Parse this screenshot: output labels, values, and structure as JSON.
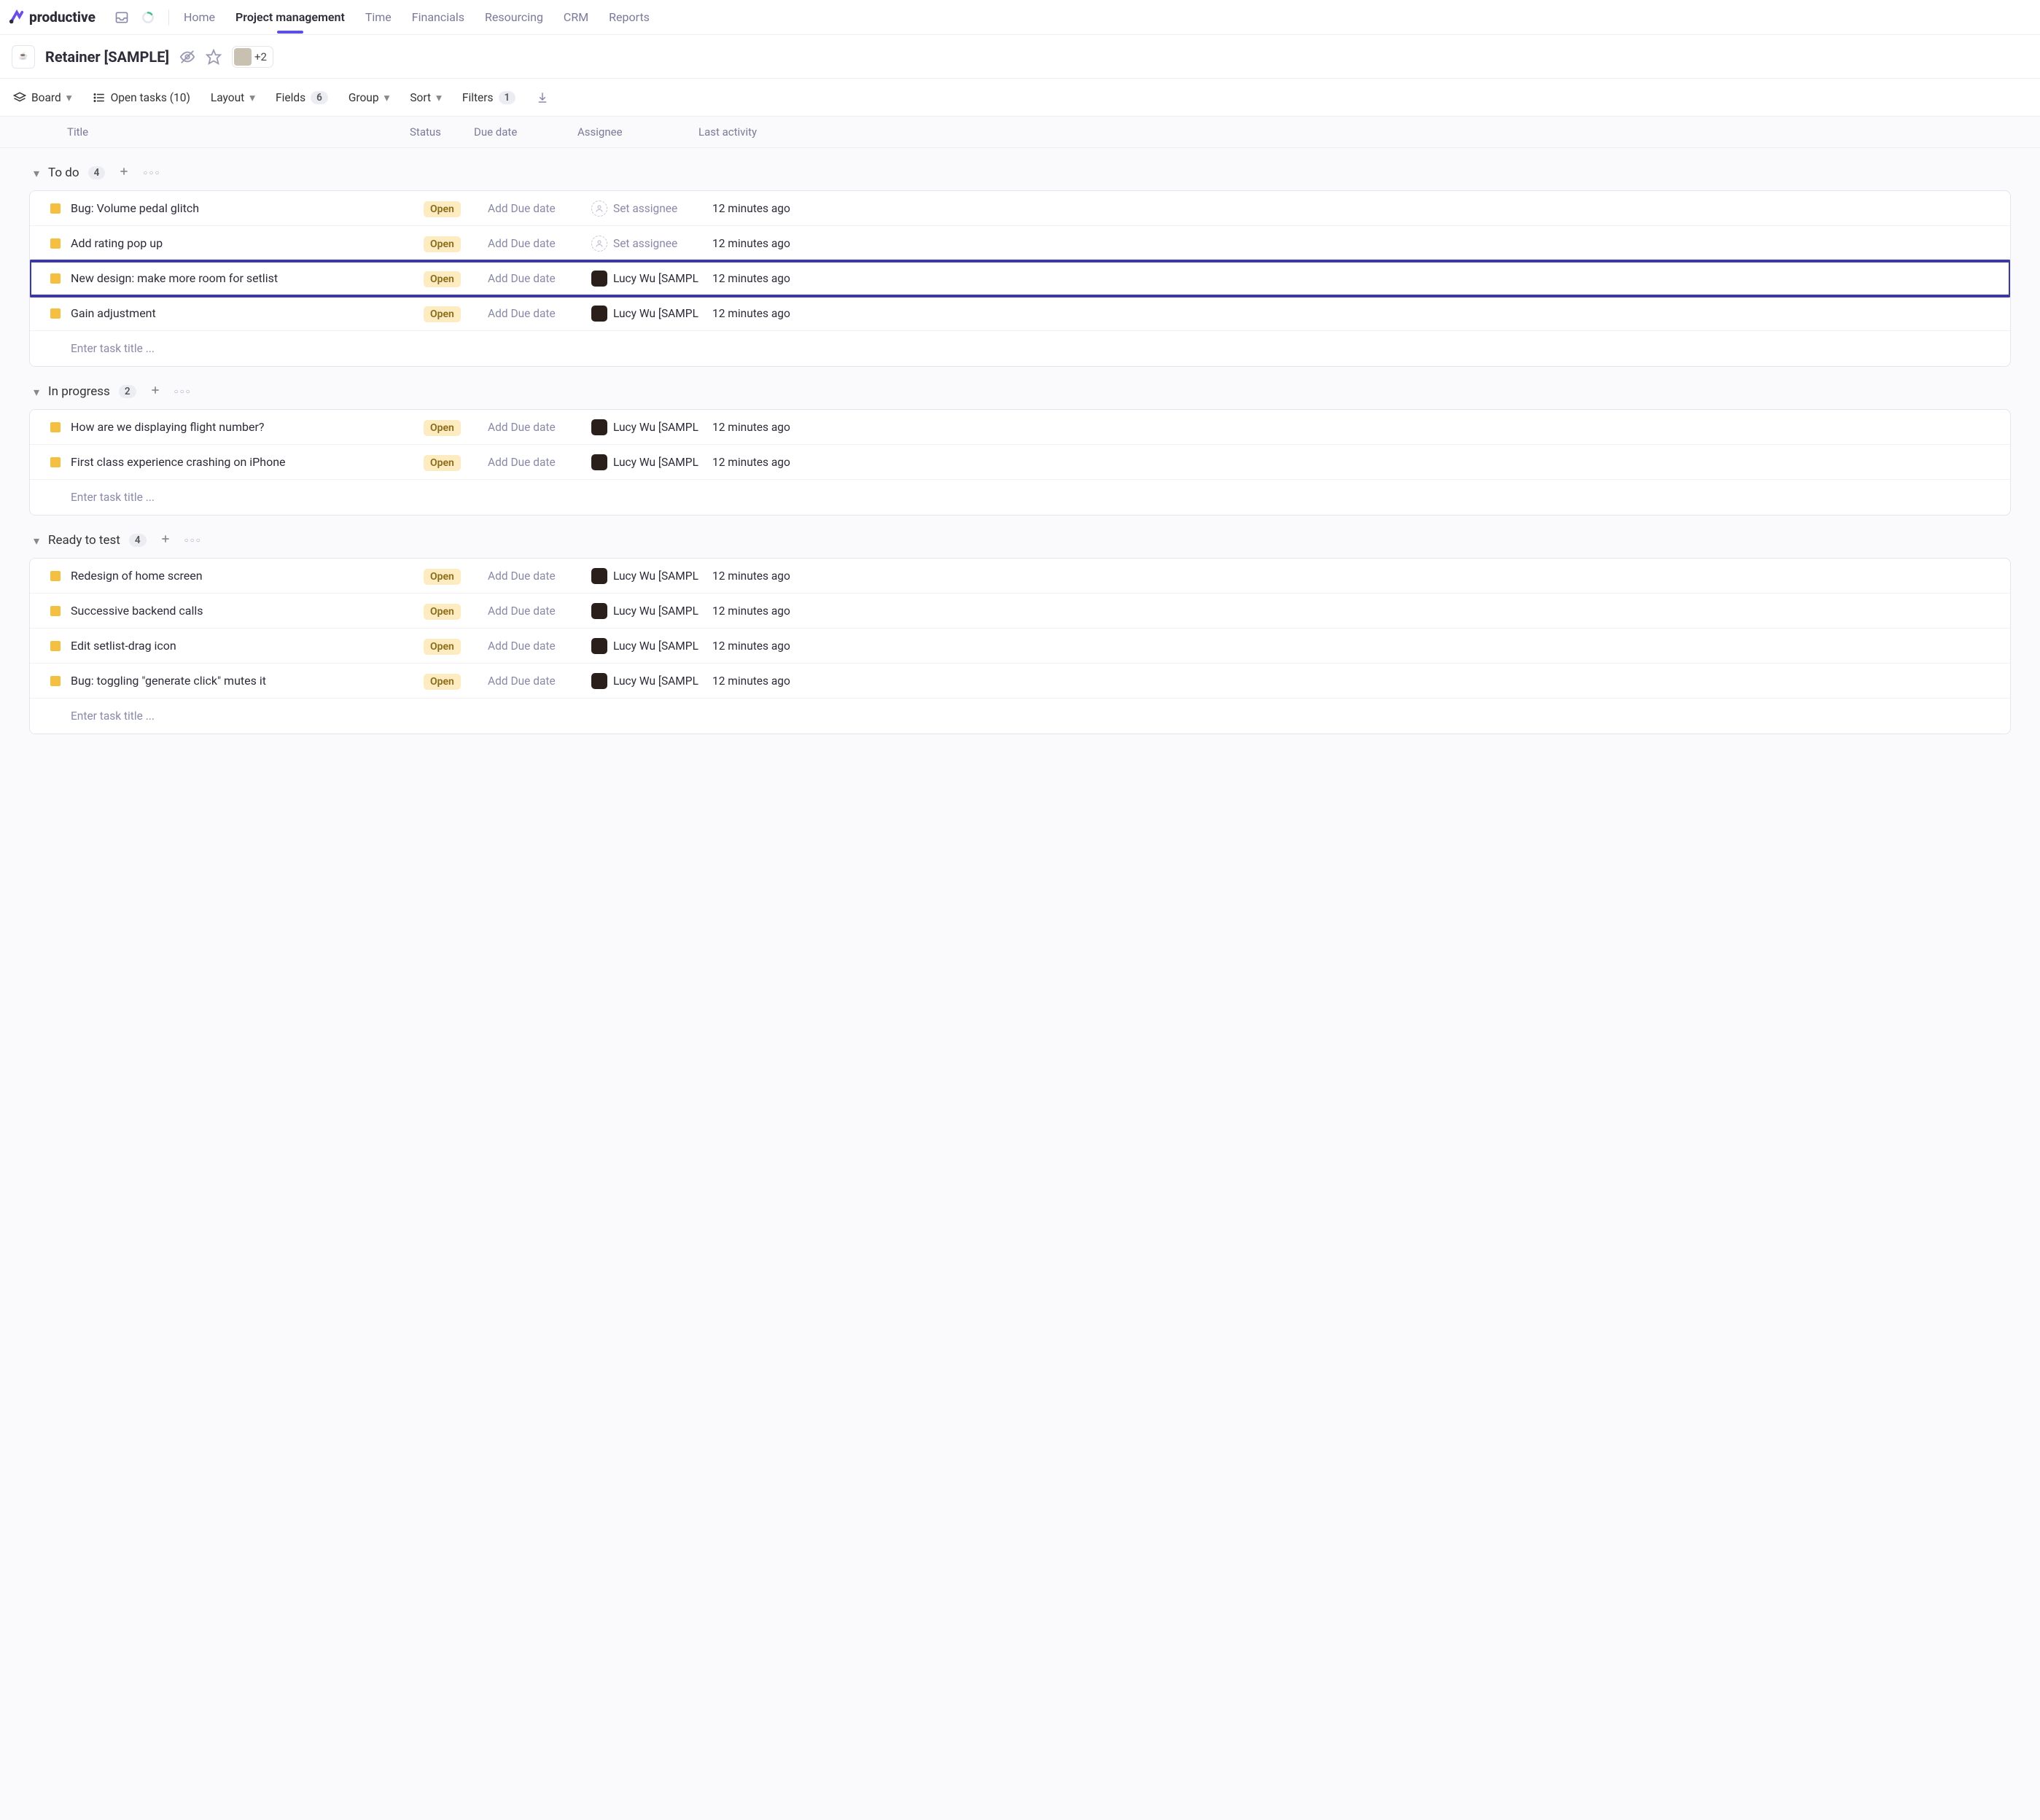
{
  "brand": "productive",
  "nav": [
    "Home",
    "Project management",
    "Time",
    "Financials",
    "Resourcing",
    "CRM",
    "Reports"
  ],
  "nav_active_index": 1,
  "project_title": "Retainer [SAMPLE]",
  "avatar_plus": "+2",
  "toolbar": {
    "view_label": "Board",
    "open_tasks_label": "Open tasks (10)",
    "layout_label": "Layout",
    "fields_label": "Fields",
    "fields_count": "6",
    "group_label": "Group",
    "sort_label": "Sort",
    "filters_label": "Filters",
    "filters_count": "1"
  },
  "columns": {
    "title": "Title",
    "status": "Status",
    "due": "Due date",
    "assignee": "Assignee",
    "activity": "Last activity"
  },
  "open_status": "Open",
  "add_due": "Add Due date",
  "set_assignee": "Set assignee",
  "new_task_placeholder": "Enter task title ...",
  "sample_user": "Lucy Wu [SAMPL",
  "activity_text": "12 minutes ago",
  "sections": [
    {
      "name": "To do",
      "count": "4",
      "tasks": [
        {
          "title": "Bug: Volume pedal glitch",
          "assignee": null,
          "highlight": false
        },
        {
          "title": "Add rating pop up",
          "assignee": null,
          "highlight": false
        },
        {
          "title": "New design: make more room for setlist",
          "assignee": "user",
          "highlight": true
        },
        {
          "title": "Gain adjustment",
          "assignee": "user",
          "highlight": false
        }
      ]
    },
    {
      "name": "In progress",
      "count": "2",
      "tasks": [
        {
          "title": "How are we displaying flight number?",
          "assignee": "user",
          "highlight": false
        },
        {
          "title": "First class experience crashing on iPhone",
          "assignee": "user",
          "highlight": false
        }
      ]
    },
    {
      "name": "Ready to test",
      "count": "4",
      "tasks": [
        {
          "title": "Redesign of home screen",
          "assignee": "user",
          "highlight": false
        },
        {
          "title": "Successive backend calls",
          "assignee": "user",
          "highlight": false
        },
        {
          "title": "Edit setlist-drag icon",
          "assignee": "user",
          "highlight": false
        },
        {
          "title": "Bug: toggling \"generate click\" mutes it",
          "assignee": "user",
          "highlight": false
        }
      ]
    }
  ]
}
